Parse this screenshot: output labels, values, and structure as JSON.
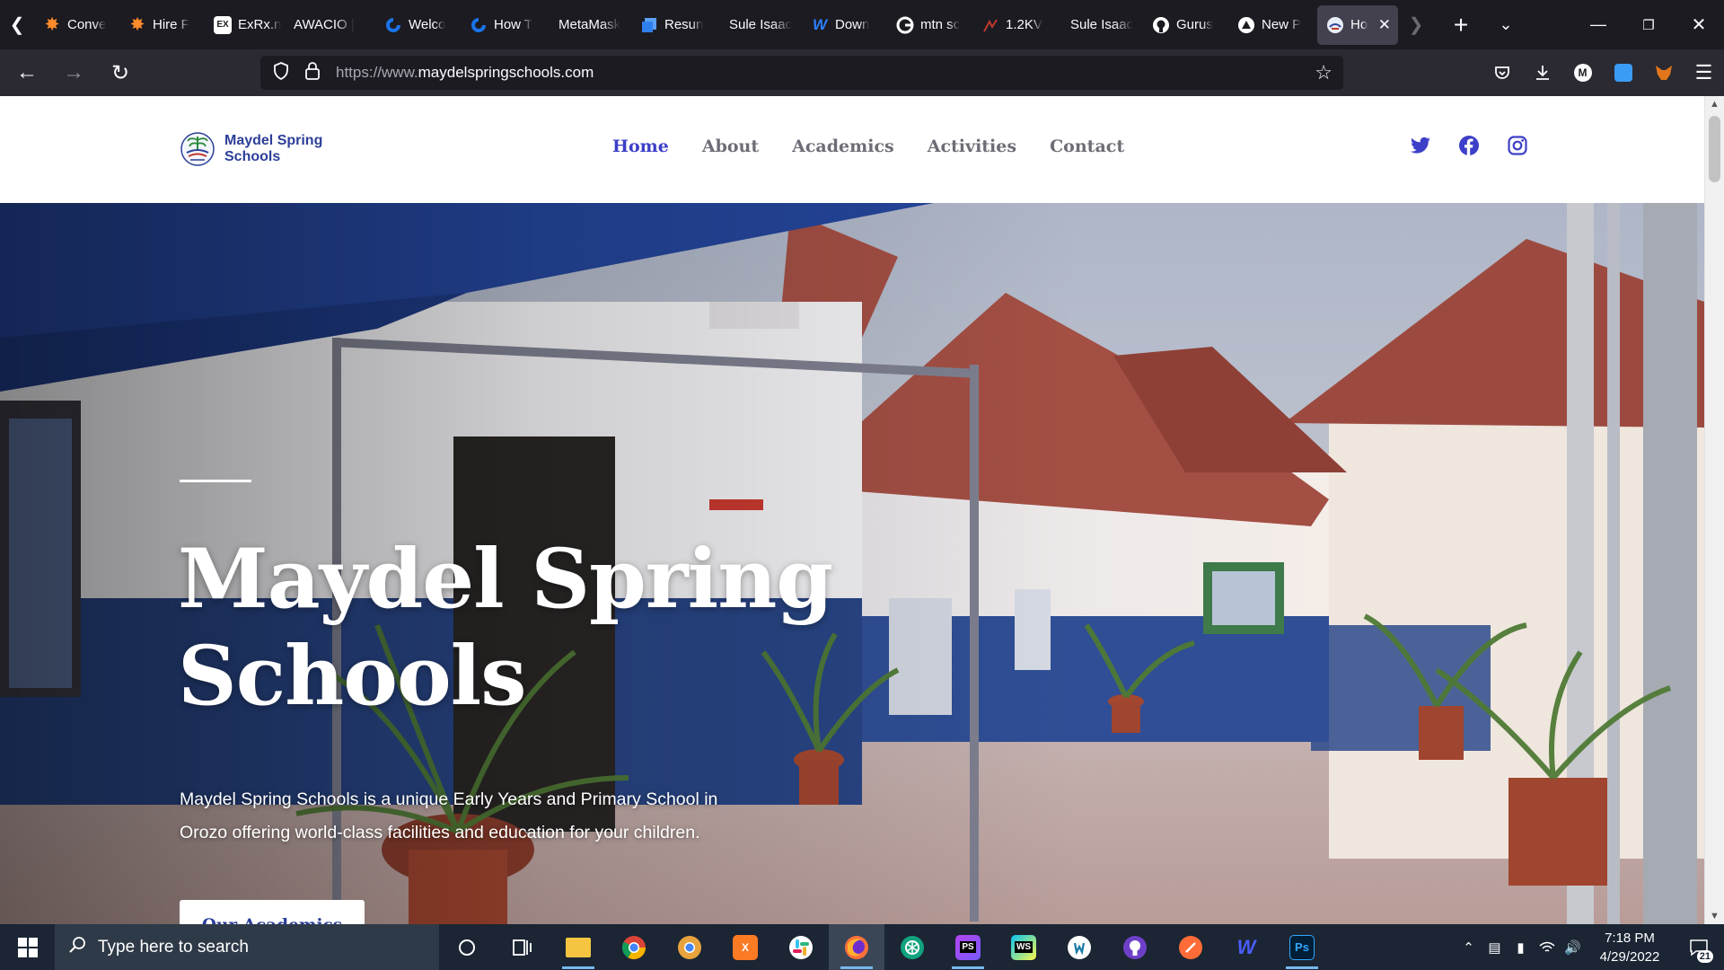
{
  "browser": {
    "tabs": [
      {
        "label": "Conve",
        "icon": "star-burst-icon",
        "color": "#ff8a2b"
      },
      {
        "label": "Hire F",
        "icon": "star-burst-icon",
        "color": "#ff8a2b"
      },
      {
        "label": "ExRx.n",
        "icon": "exrx-icon",
        "color": "#ffffff"
      },
      {
        "label": "AWACIO |",
        "icon": "blank-icon",
        "color": "#1c1b22"
      },
      {
        "label": "Welco",
        "icon": "spiral-icon",
        "color": "#1a73e8"
      },
      {
        "label": "How T",
        "icon": "spiral-icon",
        "color": "#1a73e8"
      },
      {
        "label": "MetaMask",
        "icon": "blank-icon",
        "color": "#1c1b22"
      },
      {
        "label": "Resun",
        "icon": "resume-icon",
        "color": "#2f80ed"
      },
      {
        "label": "Sule Isaac",
        "icon": "blank-icon",
        "color": "#1c1b22"
      },
      {
        "label": "Down",
        "icon": "w-logo-icon",
        "color": "#2b7fff"
      },
      {
        "label": "mtn sc",
        "icon": "google-icon",
        "color": "#ffffff"
      },
      {
        "label": "1.2KV",
        "icon": "chart-icon",
        "color": "#c0392b"
      },
      {
        "label": "Sule Isaac",
        "icon": "blank-icon",
        "color": "#1c1b22"
      },
      {
        "label": "Gurus",
        "icon": "github-icon",
        "color": "#ffffff"
      },
      {
        "label": "New P",
        "icon": "triangle-icon",
        "color": "#ffffff"
      }
    ],
    "active_tab": {
      "label": "Ho",
      "icon": "school-favicon"
    },
    "url_prefix": "https://www.",
    "url_domain": "maydelspringschools.com",
    "profile_initial": "M"
  },
  "site": {
    "logo_line1": "Maydel Spring",
    "logo_line2": "Schools",
    "nav": [
      "Home",
      "About",
      "Academics",
      "Activities",
      "Contact"
    ],
    "nav_active": "Home",
    "socials": [
      "twitter-icon",
      "facebook-icon",
      "instagram-icon"
    ],
    "colors": {
      "brand": "#2c3f98",
      "nav_active": "#3d3fc8",
      "nav": "#6d6d76"
    }
  },
  "hero": {
    "title_line1": "Maydel Spring",
    "title_line2": "Schools",
    "description_line1": "Maydel Spring Schools is a unique Early Years and Primary School in",
    "description_line2": "Orozo offering world-class facilities and education for your children.",
    "cta": "Our Academics"
  },
  "taskbar": {
    "search_placeholder": "Type here to search",
    "apps": [
      "cortana-icon",
      "task-view-icon",
      "file-explorer-icon",
      "chrome-icon",
      "chrome-canary-icon",
      "xampp-icon",
      "slack-icon",
      "firefox-icon",
      "chatgpt-icon",
      "phpstorm-icon",
      "webstorm-icon",
      "wireshark-icon",
      "github-desktop-icon",
      "postman-icon",
      "webflow-icon",
      "photoshop-icon"
    ],
    "time": "7:18 PM",
    "date": "4/29/2022",
    "notifications": "21"
  }
}
